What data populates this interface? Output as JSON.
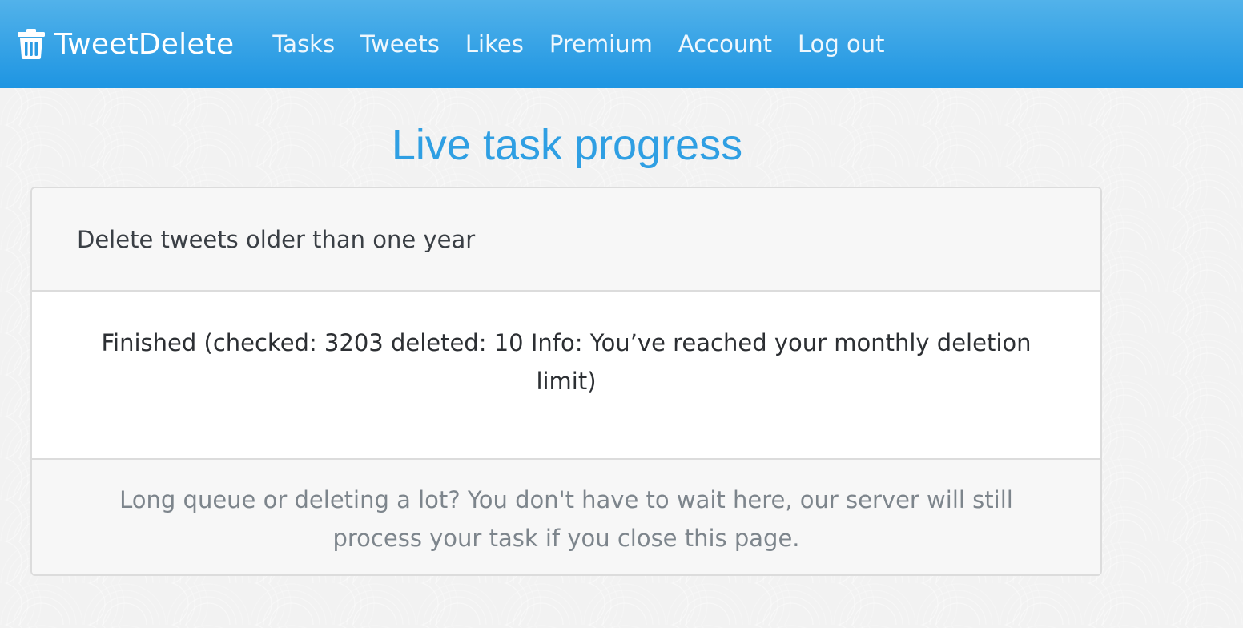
{
  "navbar": {
    "brand": {
      "icon": "trash-icon",
      "label": "TweetDelete"
    },
    "links": [
      {
        "label": "Tasks"
      },
      {
        "label": "Tweets"
      },
      {
        "label": "Likes"
      },
      {
        "label": "Premium"
      },
      {
        "label": "Account"
      },
      {
        "label": "Log out"
      }
    ]
  },
  "page": {
    "title": "Live task progress"
  },
  "task_card": {
    "task_name": "Delete tweets older than one year",
    "status": "Finished (checked: 3203 deleted: 10 Info: You’ve reached your monthly deletion limit)",
    "footer_note": "Long queue or deleting a lot? You don't have to wait here, our server will still process your task if you close this page."
  },
  "colors": {
    "navbar_top": "#52b2ea",
    "navbar_bottom": "#1e95e2",
    "title": "#2f9fe3",
    "page_background": "#f2f2f2"
  }
}
